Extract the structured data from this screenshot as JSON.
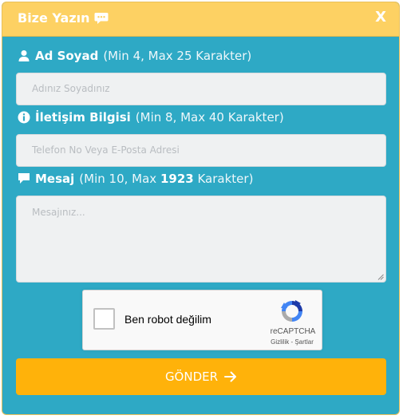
{
  "header": {
    "title": "Bize Yazın",
    "close_label": "X"
  },
  "fields": {
    "name": {
      "label": "Ad Soyad",
      "hint": "(Min 4, Max 25 Karakter)",
      "placeholder": "Adınız Soyadınız"
    },
    "contact": {
      "label": "İletişim Bilgisi",
      "hint": "(Min 8, Max 40 Karakter)",
      "placeholder": "Telefon No Veya E-Posta Adresi"
    },
    "message": {
      "label": "Mesaj",
      "hint_prefix": "(Min 10, Max",
      "max_chars": "1923",
      "hint_suffix": "Karakter)",
      "placeholder": "Mesajınız..."
    }
  },
  "captcha": {
    "checkbox_label": "Ben robot değilim",
    "brand": "reCAPTCHA",
    "links": "Gizlilik - Şartlar"
  },
  "submit": {
    "label": "GÖNDER"
  },
  "colors": {
    "panel": "#2ea9c5",
    "header": "#fdd163",
    "submit": "#ffb20a",
    "field": "#eff1f2"
  },
  "icons": {
    "title": "chat-bubble-icon",
    "name": "user-icon",
    "contact": "info-icon",
    "message": "comment-icon",
    "submit": "arrow-right-icon"
  }
}
